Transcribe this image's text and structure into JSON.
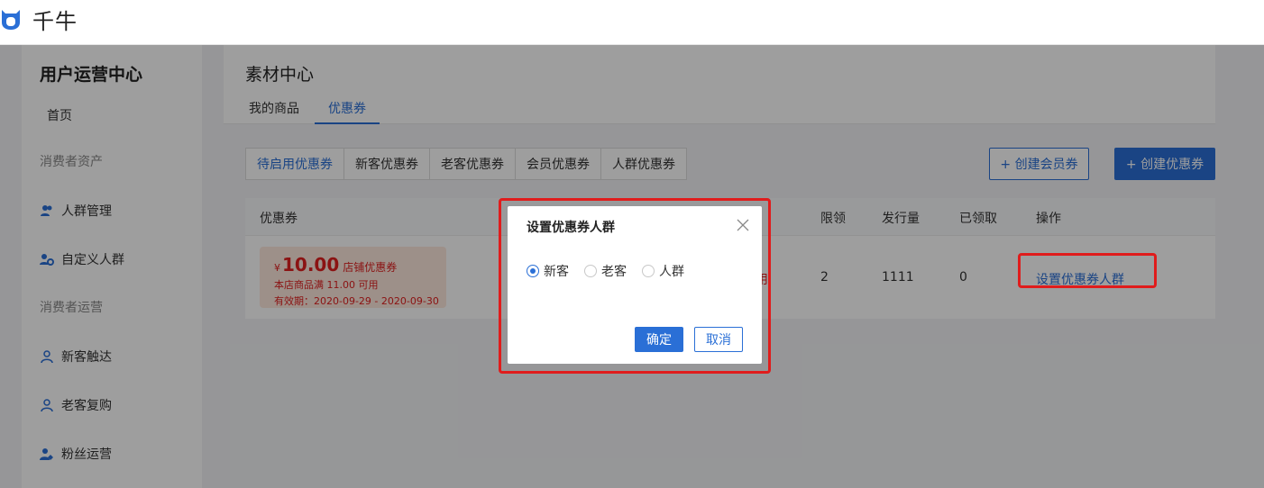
{
  "brand": {
    "name": "千牛",
    "color": "#2a6fd6"
  },
  "sidebar": {
    "title": "用户运营中心",
    "home": "首页",
    "group_assets": "消费者资产",
    "item_crowd": "人群管理",
    "item_custom_crowd": "自定义人群",
    "group_ops": "消费者运营",
    "item_new": "新客触达",
    "item_repurchase": "老客复购",
    "item_fans": "粉丝运营"
  },
  "content": {
    "title": "素材中心",
    "tabs": [
      "我的商品",
      "优惠券"
    ],
    "active_tab": "优惠券"
  },
  "toolbar": {
    "segments": [
      "待启用优惠券",
      "新客优惠券",
      "老客优惠券",
      "会员优惠券",
      "人群优惠券"
    ],
    "create_member": "+ 创建会员券",
    "create_coupon": "+ 创建优惠券"
  },
  "table": {
    "headers": {
      "coupon": "优惠券",
      "limit": "限领",
      "issued": "发行量",
      "claimed": "已领取",
      "action": "操作"
    },
    "row": {
      "currency": "¥",
      "amount": "10.00",
      "kind": "店铺优惠券",
      "condition": "本店商品满 11.00 可用",
      "validity": "有效期：2020-09-29 - 2020-09-30",
      "status_fragment": "用",
      "limit": "2",
      "issued": "1111",
      "claimed": "0",
      "action": "设置优惠券人群"
    }
  },
  "modal": {
    "title": "设置优惠券人群",
    "options": [
      "新客",
      "老客",
      "人群"
    ],
    "selected": "新客",
    "ok": "确定",
    "cancel": "取消"
  },
  "colors": {
    "highlight": "#e01c1c",
    "accent": "#2a6fd6",
    "danger": "#e02020"
  }
}
